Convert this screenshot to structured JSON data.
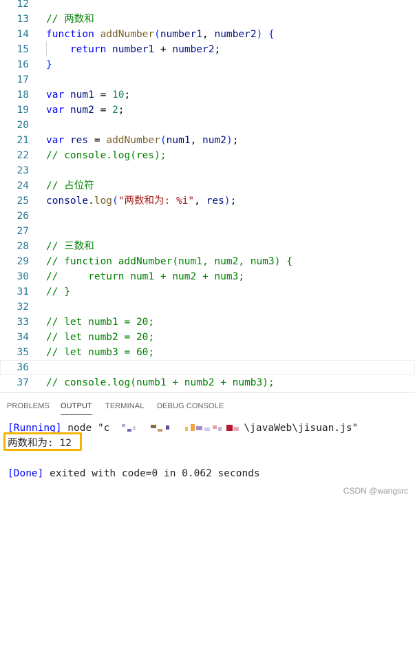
{
  "editor": {
    "lines": [
      {
        "n": "12",
        "parts": []
      },
      {
        "n": "13",
        "parts": [
          [
            "cm",
            "// 两数和"
          ]
        ]
      },
      {
        "n": "14",
        "parts": [
          [
            "kw",
            "function"
          ],
          [
            "pl",
            " "
          ],
          [
            "fn",
            "addNumber"
          ],
          [
            "p1",
            "("
          ],
          [
            "var",
            "number1"
          ],
          [
            "pl",
            ", "
          ],
          [
            "var",
            "number2"
          ],
          [
            "p1",
            ")"
          ],
          [
            "pl",
            " "
          ],
          [
            "p1",
            "{"
          ]
        ]
      },
      {
        "n": "15",
        "parts": [
          [
            "pl",
            "    "
          ],
          [
            "kw",
            "return"
          ],
          [
            "pl",
            " "
          ],
          [
            "var",
            "number1"
          ],
          [
            "pl",
            " + "
          ],
          [
            "var",
            "number2"
          ],
          [
            "pl",
            ";"
          ]
        ]
      },
      {
        "n": "16",
        "parts": [
          [
            "p1",
            "}"
          ]
        ]
      },
      {
        "n": "17",
        "parts": []
      },
      {
        "n": "18",
        "parts": [
          [
            "kw",
            "var"
          ],
          [
            "pl",
            " "
          ],
          [
            "var",
            "num1"
          ],
          [
            "pl",
            " = "
          ],
          [
            "num",
            "10"
          ],
          [
            "pl",
            ";"
          ]
        ]
      },
      {
        "n": "19",
        "parts": [
          [
            "kw",
            "var"
          ],
          [
            "pl",
            " "
          ],
          [
            "var",
            "num2"
          ],
          [
            "pl",
            " = "
          ],
          [
            "num",
            "2"
          ],
          [
            "pl",
            ";"
          ]
        ]
      },
      {
        "n": "20",
        "parts": []
      },
      {
        "n": "21",
        "parts": [
          [
            "kw",
            "var"
          ],
          [
            "pl",
            " "
          ],
          [
            "var",
            "res"
          ],
          [
            "pl",
            " = "
          ],
          [
            "fn",
            "addNumber"
          ],
          [
            "p1",
            "("
          ],
          [
            "var",
            "num1"
          ],
          [
            "pl",
            ", "
          ],
          [
            "var",
            "num2"
          ],
          [
            "p1",
            ")"
          ],
          [
            "pl",
            ";"
          ]
        ]
      },
      {
        "n": "22",
        "parts": [
          [
            "cm",
            "// console.log(res);"
          ]
        ]
      },
      {
        "n": "23",
        "parts": []
      },
      {
        "n": "24",
        "parts": [
          [
            "cm",
            "// 占位符"
          ]
        ]
      },
      {
        "n": "25",
        "parts": [
          [
            "var",
            "console"
          ],
          [
            "pl",
            "."
          ],
          [
            "fn",
            "log"
          ],
          [
            "p1",
            "("
          ],
          [
            "str",
            "\"两数和为: %i\""
          ],
          [
            "pl",
            ", "
          ],
          [
            "var",
            "res"
          ],
          [
            "p1",
            ")"
          ],
          [
            "pl",
            ";"
          ]
        ]
      },
      {
        "n": "26",
        "parts": []
      },
      {
        "n": "27",
        "parts": []
      },
      {
        "n": "28",
        "parts": [
          [
            "cm",
            "// 三数和"
          ]
        ]
      },
      {
        "n": "29",
        "parts": [
          [
            "cm",
            "// function addNumber(num1, num2, num3) {"
          ]
        ]
      },
      {
        "n": "30",
        "parts": [
          [
            "cm",
            "//     return num1 + num2 + num3;"
          ]
        ]
      },
      {
        "n": "31",
        "parts": [
          [
            "cm",
            "// }"
          ]
        ]
      },
      {
        "n": "32",
        "parts": []
      },
      {
        "n": "33",
        "parts": [
          [
            "cm",
            "// let numb1 = 20;"
          ]
        ]
      },
      {
        "n": "34",
        "parts": [
          [
            "cm",
            "// let numb2 = 20;"
          ]
        ]
      },
      {
        "n": "35",
        "parts": [
          [
            "cm",
            "// let numb3 = 60;"
          ]
        ]
      },
      {
        "n": "36",
        "parts": [],
        "current": true
      },
      {
        "n": "37",
        "parts": [
          [
            "cm",
            "// console.log(numb1 + numb2 + numb3);"
          ]
        ]
      }
    ]
  },
  "panel": {
    "tabs": [
      {
        "id": "problems",
        "label": "PROBLEMS"
      },
      {
        "id": "output",
        "label": "OUTPUT",
        "active": true
      },
      {
        "id": "terminal",
        "label": "TERMINAL"
      },
      {
        "id": "debug-console",
        "label": "DEBUG CONSOLE"
      }
    ],
    "output": {
      "running_tag": "[Running]",
      "running_cmd_prefix": " node \"c",
      "running_cmd_suffix": "\\javaWeb\\jisuan.js\"",
      "result_line": "两数和为: 12",
      "done_tag": "[Done]",
      "done_text": " exited with code=0 in 0.062 seconds"
    },
    "highlight_color": "#f4b400"
  },
  "watermark": "CSDN @wangsrc"
}
